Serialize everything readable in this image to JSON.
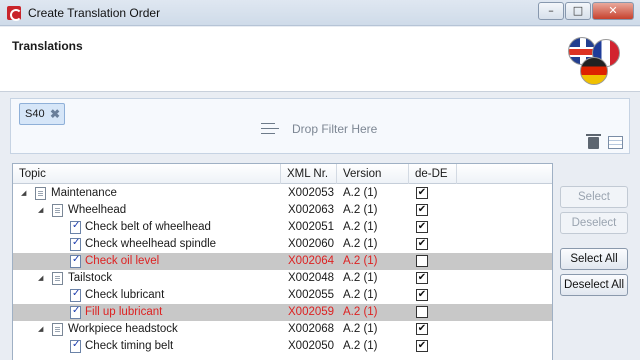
{
  "window": {
    "title": "Create Translation Order",
    "minimize": "–",
    "maximize": "□",
    "close": "✕"
  },
  "header": {
    "title": "Translations",
    "flags": [
      "uk-flag-icon",
      "fr-flag-icon",
      "de-flag-icon"
    ]
  },
  "filter": {
    "chip": {
      "label": "S40",
      "remove": "✖"
    },
    "drop_text": "Drop Filter Here"
  },
  "table": {
    "columns": [
      "Topic",
      "XML Nr.",
      "Version",
      "de-DE"
    ],
    "rows": [
      {
        "indent": 0,
        "type": "folder",
        "expanded": true,
        "label": "Maintenance",
        "xml": "X002053",
        "version": "A.2 (1)",
        "checked": true,
        "selected": false
      },
      {
        "indent": 1,
        "type": "folder",
        "expanded": true,
        "label": "Wheelhead",
        "xml": "X002063",
        "version": "A.2 (1)",
        "checked": true,
        "selected": false
      },
      {
        "indent": 2,
        "type": "task",
        "label": "Check belt of wheelhead",
        "xml": "X002051",
        "version": "A.2 (1)",
        "checked": true,
        "selected": false
      },
      {
        "indent": 2,
        "type": "task",
        "label": "Check wheelhead spindle",
        "xml": "X002060",
        "version": "A.2 (1)",
        "checked": true,
        "selected": false
      },
      {
        "indent": 2,
        "type": "task",
        "label": "Check oil level",
        "xml": "X002064",
        "version": "A.2 (1)",
        "checked": false,
        "selected": true
      },
      {
        "indent": 1,
        "type": "folder",
        "expanded": true,
        "label": "Tailstock",
        "xml": "X002048",
        "version": "A.2 (1)",
        "checked": true,
        "selected": false
      },
      {
        "indent": 2,
        "type": "task",
        "label": "Check lubricant",
        "xml": "X002055",
        "version": "A.2 (1)",
        "checked": true,
        "selected": false
      },
      {
        "indent": 2,
        "type": "task",
        "label": "Fill up lubricant",
        "xml": "X002059",
        "version": "A.2 (1)",
        "checked": false,
        "selected": true
      },
      {
        "indent": 1,
        "type": "folder",
        "expanded": true,
        "label": "Workpiece headstock",
        "xml": "X002068",
        "version": "A.2 (1)",
        "checked": true,
        "selected": false
      },
      {
        "indent": 2,
        "type": "task",
        "label": "Check timing belt",
        "xml": "X002050",
        "version": "A.2 (1)",
        "checked": true,
        "selected": false
      }
    ]
  },
  "buttons": {
    "select": "Select",
    "deselect": "Deselect",
    "select_all": "Select All",
    "deselect_all": "Deselect All"
  },
  "colors": {
    "selected_text": "#d22222",
    "selected_row": "#c8c8c8"
  }
}
